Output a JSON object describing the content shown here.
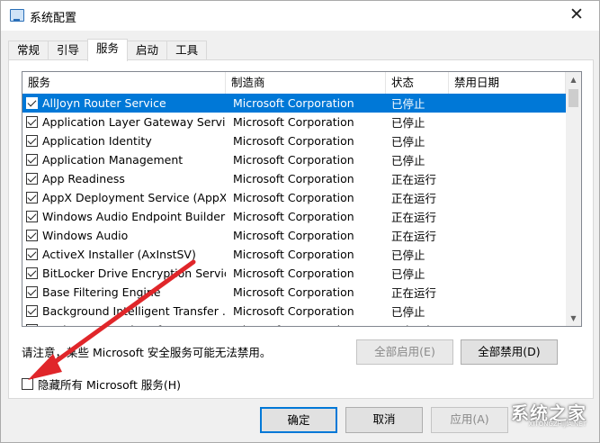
{
  "window": {
    "title": "系统配置",
    "close_glyph": "✕"
  },
  "tabs": [
    {
      "label": "常规"
    },
    {
      "label": "引导"
    },
    {
      "label": "服务",
      "active": true
    },
    {
      "label": "启动"
    },
    {
      "label": "工具"
    }
  ],
  "services": {
    "columns": [
      "服务",
      "制造商",
      "状态",
      "禁用日期"
    ],
    "rows": [
      {
        "name": "AllJoyn Router Service",
        "vendor": "Microsoft Corporation",
        "status": "已停止",
        "checked": true,
        "selected": true
      },
      {
        "name": "Application Layer Gateway Service",
        "vendor": "Microsoft Corporation",
        "status": "已停止",
        "checked": true
      },
      {
        "name": "Application Identity",
        "vendor": "Microsoft Corporation",
        "status": "已停止",
        "checked": true
      },
      {
        "name": "Application Management",
        "vendor": "Microsoft Corporation",
        "status": "已停止",
        "checked": true
      },
      {
        "name": "App Readiness",
        "vendor": "Microsoft Corporation",
        "status": "正在运行",
        "checked": true
      },
      {
        "name": "AppX Deployment Service (AppX...",
        "vendor": "Microsoft Corporation",
        "status": "正在运行",
        "checked": true
      },
      {
        "name": "Windows Audio Endpoint Builder",
        "vendor": "Microsoft Corporation",
        "status": "正在运行",
        "checked": true
      },
      {
        "name": "Windows Audio",
        "vendor": "Microsoft Corporation",
        "status": "正在运行",
        "checked": true
      },
      {
        "name": "ActiveX Installer (AxInstSV)",
        "vendor": "Microsoft Corporation",
        "status": "已停止",
        "checked": true
      },
      {
        "name": "BitLocker Drive Encryption Service",
        "vendor": "Microsoft Corporation",
        "status": "已停止",
        "checked": true
      },
      {
        "name": "Base Filtering Engine",
        "vendor": "Microsoft Corporation",
        "status": "正在运行",
        "checked": true
      },
      {
        "name": "Background Intelligent Transfer ...",
        "vendor": "Microsoft Corporation",
        "status": "已停止",
        "checked": true
      },
      {
        "name": "Background Tasks Infrastructure...",
        "vendor": "Microsoft Corporation",
        "status": "正在运行",
        "checked": true
      }
    ]
  },
  "note": "请注意，某些 Microsoft 安全服务可能无法禁用。",
  "buttons": {
    "enable_all": "全部启用(E)",
    "disable_all": "全部禁用(D)",
    "ok": "确定",
    "cancel": "取消",
    "apply": "应用(A)"
  },
  "hide_ms": {
    "label": "隐藏所有 Microsoft 服务(H)",
    "checked": false
  },
  "watermark": {
    "text": "系统之家",
    "url": "XITONGZHIJIA.NET"
  },
  "annotation": {
    "arrow_color": "#e0262a"
  }
}
